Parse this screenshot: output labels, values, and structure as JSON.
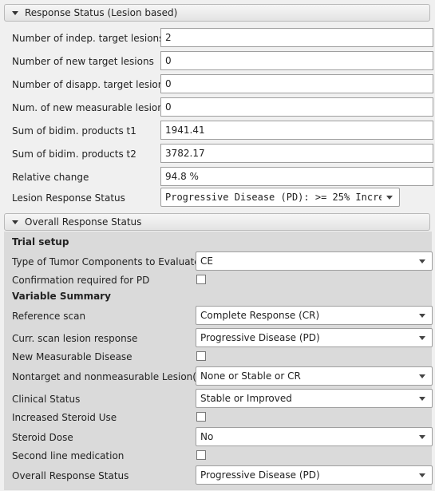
{
  "section1": {
    "title": "Response Status (Lesion based)",
    "rows": [
      {
        "label": "Number of indep. target lesions",
        "value": "2"
      },
      {
        "label": "Number of new target lesions",
        "value": "0"
      },
      {
        "label": "Number of disapp. target lesions",
        "value": "0"
      },
      {
        "label": "Num. of new measurable lesions",
        "value": "0"
      },
      {
        "label": "Sum of bidim. products t1",
        "value": "1941.41"
      },
      {
        "label": "Sum of bidim. products t2",
        "value": "3782.17"
      },
      {
        "label": "Relative change",
        "value": "94.8 %"
      }
    ],
    "lesion_status": {
      "label": "Lesion Response Status",
      "value": "Progressive Disease (PD): >= 25% Incre"
    }
  },
  "section2": {
    "title": "Overall Response Status",
    "trial_setup": {
      "heading": "Trial setup",
      "tumor_components": {
        "label": "Type of Tumor Components to Evaluate",
        "value": "CE"
      },
      "confirmation_pd": {
        "label": "Confirmation required for PD"
      }
    },
    "variable_summary": {
      "heading": "Variable Summary",
      "reference_scan": {
        "label": "Reference scan",
        "value": "Complete Response (CR)"
      },
      "curr_scan": {
        "label": "Curr. scan lesion response",
        "value": "Progressive Disease (PD)"
      },
      "new_measurable": {
        "label": "New Measurable Disease"
      },
      "nontarget": {
        "label": "Nontarget and nonmeasurable Lesion(s)",
        "value": "None or Stable or CR"
      },
      "clinical_status": {
        "label": "Clinical Status",
        "value": "Stable or Improved"
      },
      "steroid_use": {
        "label": "Increased Steroid Use"
      },
      "steroid_dose": {
        "label": "Steroid Dose",
        "value": "No"
      },
      "second_line": {
        "label": "Second line medication"
      },
      "overall_status": {
        "label": "Overall Response Status",
        "value": "Progressive Disease (PD)"
      }
    }
  }
}
